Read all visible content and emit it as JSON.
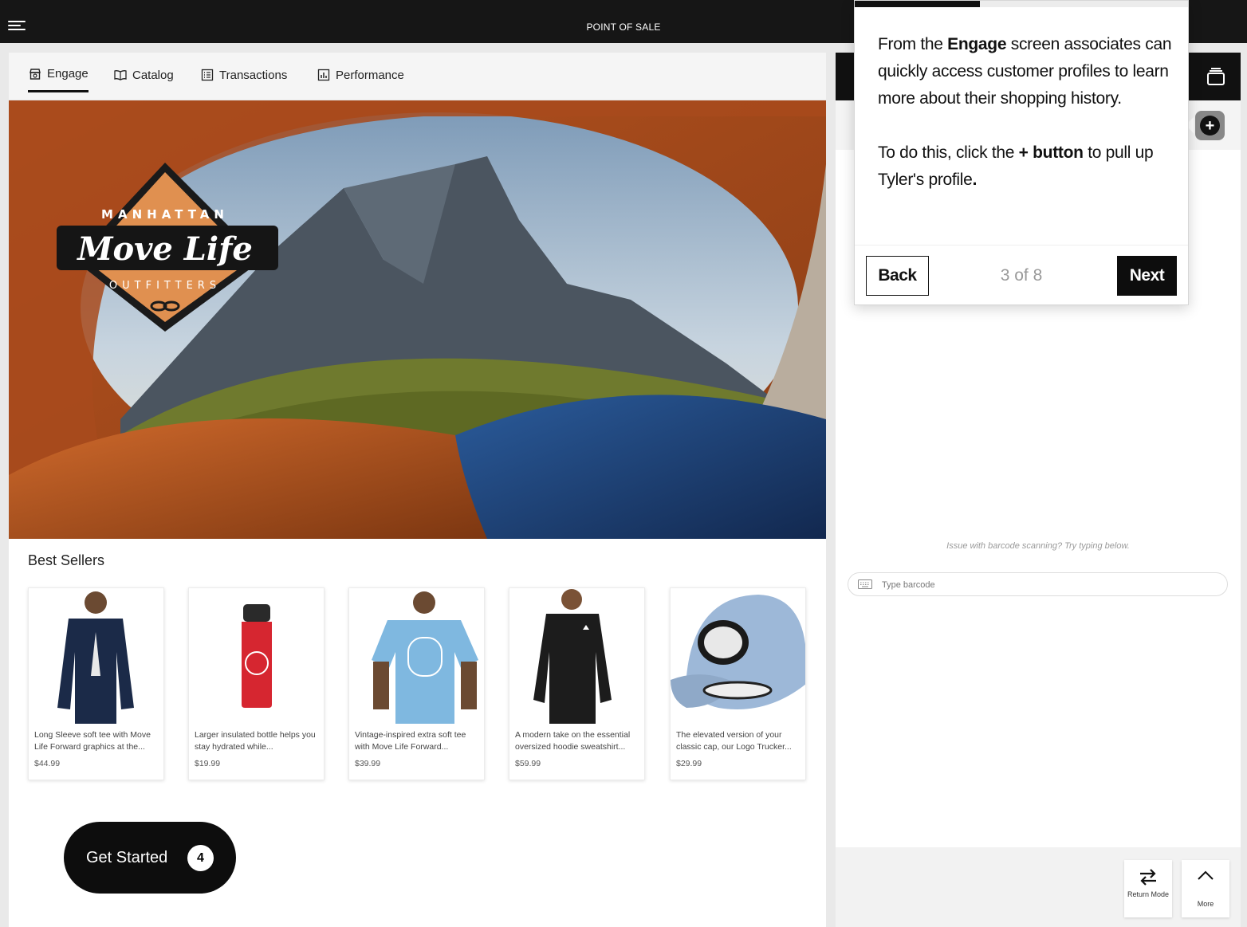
{
  "header": {
    "title": "POINT OF SALE"
  },
  "tabs": [
    {
      "label": "Engage",
      "icon": "store-icon"
    },
    {
      "label": "Catalog",
      "icon": "book-icon"
    },
    {
      "label": "Transactions",
      "icon": "list-icon"
    },
    {
      "label": "Performance",
      "icon": "bar-chart-icon"
    }
  ],
  "hero": {
    "logo_top": "MANHATTAN",
    "logo_main": "Move Life",
    "logo_bottom": "OUTFITTERS"
  },
  "best_sellers": {
    "title": "Best Sellers",
    "products": [
      {
        "desc": "Long Sleeve soft tee with Move Life Forward graphics at the...",
        "price": "$44.99",
        "color": "#1b2a48"
      },
      {
        "desc": "Larger insulated bottle helps you stay hydrated while...",
        "price": "$19.99",
        "color": "#d62630"
      },
      {
        "desc": "Vintage-inspired extra soft tee with Move Life Forward...",
        "price": "$39.99",
        "color": "#7fb8e0"
      },
      {
        "desc": "A modern take on the essential oversized hoodie sweatshirt...",
        "price": "$59.99",
        "color": "#1c1c1c"
      },
      {
        "desc": "The elevated version of your classic cap, our Logo Trucker...",
        "price": "$29.99",
        "color": "#9db8d8"
      }
    ]
  },
  "get_started": {
    "label": "Get Started",
    "count": "4"
  },
  "right_panel": {
    "scan_hint": "Issue with barcode scanning? Try typing below.",
    "barcode_placeholder": "Type barcode",
    "return_mode_label": "Return Mode",
    "more_label": "More"
  },
  "tooltip": {
    "line1_pre": "From the ",
    "line1_bold": "Engage",
    "line1_post": " screen associates can quickly access customer profiles to learn more about their shopping history.",
    "line2_pre": "To do this, click the ",
    "line2_bold": "+ button",
    "line2_post": " to pull up Tyler's profile",
    "line2_end": ".",
    "back_label": "Back",
    "next_label": "Next",
    "step": "3 of 8",
    "progress": 0.375
  },
  "colors": {
    "dark": "#111111",
    "accent_orange": "#d98a4e"
  }
}
